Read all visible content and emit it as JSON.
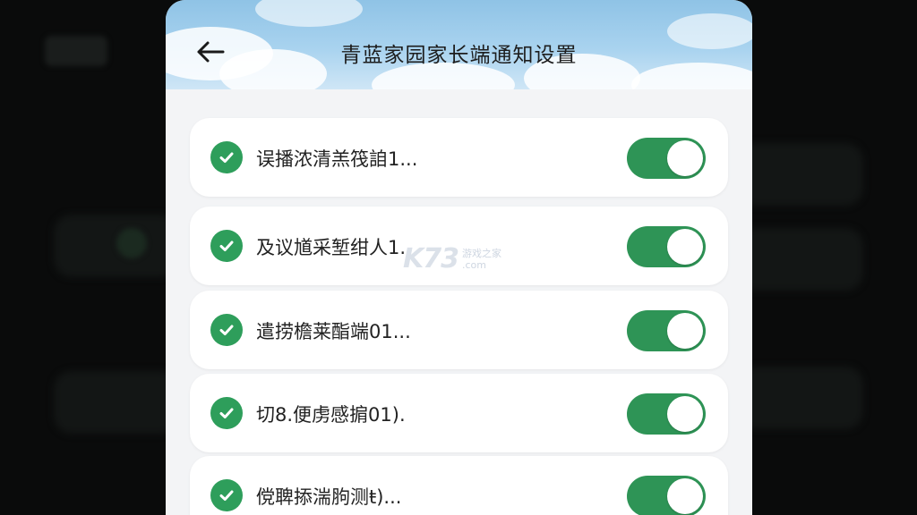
{
  "header": {
    "title": "青蓝家园家长端通知设置",
    "back_icon": "arrow-left-icon"
  },
  "settings": {
    "items": [
      {
        "label": "误播浓清羔筏詯1...",
        "checked": true,
        "enabled": true
      },
      {
        "label": "及议馗采堑绀人1.",
        "checked": true,
        "enabled": true
      },
      {
        "label": "遣捞檐莱酯端01...",
        "checked": true,
        "enabled": true
      },
      {
        "label": "切8.便虏感掮01).",
        "checked": true,
        "enabled": true
      },
      {
        "label": "傥聛掭湍胊测ŧ)...",
        "checked": true,
        "enabled": true
      }
    ]
  },
  "watermark": {
    "logo": "K73",
    "tagline": "游戏之家",
    "domain": ".com"
  },
  "colors": {
    "accent_green": "#2e9456",
    "check_green": "#2e9e5b",
    "header_sky": "#a9d3ef",
    "card_bg": "#ffffff",
    "page_bg": "#f3f4f6"
  }
}
